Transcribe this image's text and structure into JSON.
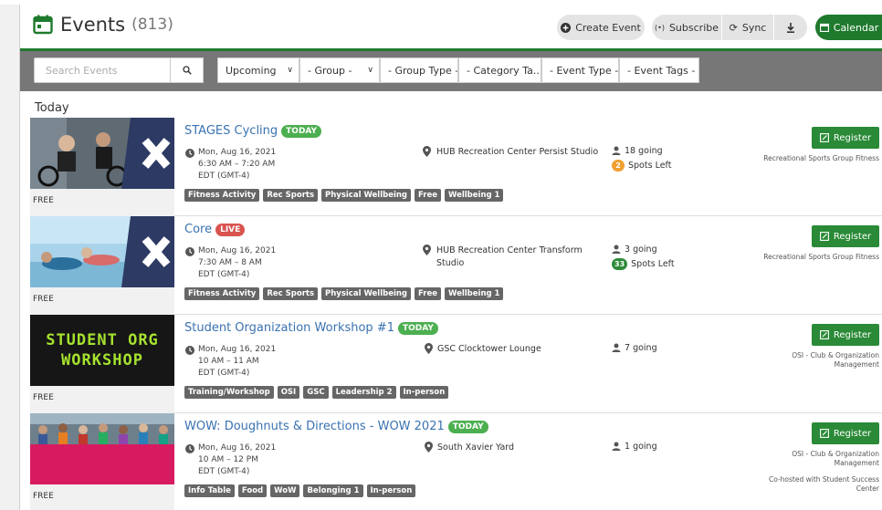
{
  "header": {
    "title": "Events",
    "count": "(813)",
    "buttons": {
      "create": "Create Event",
      "subscribe": "Subscribe",
      "sync": "Sync",
      "calendar": "Calendar"
    }
  },
  "filters": {
    "search_placeholder": "Search Events",
    "selects": [
      "Upcoming",
      "- Group -",
      "- Group Type -",
      "- Category Ta...",
      "- Event Type -",
      "- Event Tags -"
    ]
  },
  "section_label": "Today",
  "events": [
    {
      "title": "STAGES Cycling",
      "badge": "TODAY",
      "date": "Mon, Aug 16, 2021",
      "time": "6:30 AM – 7:20 AM",
      "tz": "EDT (GMT-4)",
      "location": "HUB Recreation Center Persist Studio",
      "going": "18 going",
      "spots_num": "2",
      "spots_text": "Spots Left",
      "tags": [
        "Fitness Activity",
        "Rec Sports",
        "Physical Wellbeing",
        "Free",
        "Wellbeing 1"
      ],
      "price": "FREE",
      "register": "Register",
      "org": "Recreational Sports Group Fitness"
    },
    {
      "title": "Core",
      "badge": "LIVE",
      "date": "Mon, Aug 16, 2021",
      "time": "7:30 AM – 8 AM",
      "tz": "EDT (GMT-4)",
      "location": "HUB Recreation Center Transform Studio",
      "going": "3 going",
      "spots_num": "33",
      "spots_text": "Spots Left",
      "tags": [
        "Fitness Activity",
        "Rec Sports",
        "Physical Wellbeing",
        "Free",
        "Wellbeing 1"
      ],
      "price": "FREE",
      "register": "Register",
      "org": "Recreational Sports Group Fitness"
    },
    {
      "title": "Student Organization Workshop #1",
      "badge": "TODAY",
      "date": "Mon, Aug 16, 2021",
      "time": "10 AM – 11 AM",
      "tz": "EDT (GMT-4)",
      "location": "GSC Clocktower Lounge",
      "going": "7 going",
      "tags": [
        "Training/Workshop",
        "OSI",
        "GSC",
        "Leadership 2",
        "In-person"
      ],
      "price": "FREE",
      "register": "Register",
      "org": "OSI - Club & Organization Management",
      "thumb_text": [
        "STUDENT ORG",
        "WORKSHOP"
      ]
    },
    {
      "title": "WOW: Doughnuts & Directions - WOW 2021",
      "badge": "TODAY",
      "date": "Mon, Aug 16, 2021",
      "time": "10 AM – 12 PM",
      "tz": "EDT (GMT-4)",
      "location": "South Xavier Yard",
      "going": "1 going",
      "tags": [
        "Info Table",
        "Food",
        "WoW",
        "Belonging 1",
        "In-person"
      ],
      "price": "FREE",
      "register": "Register",
      "org": "OSI - Club & Organization Management",
      "cohost": "Co-hosted with Student Success Center"
    }
  ],
  "colors": {
    "brand_green": "#1f7a2e",
    "register_green": "#2a8a37",
    "link_blue": "#3a72b0",
    "badge_today": "#4caf50",
    "badge_live": "#d9534f",
    "spots_orange": "#f0a030",
    "spots_green": "#2e8b3a",
    "filter_bar": "#777777",
    "tag_gray": "#666666"
  }
}
